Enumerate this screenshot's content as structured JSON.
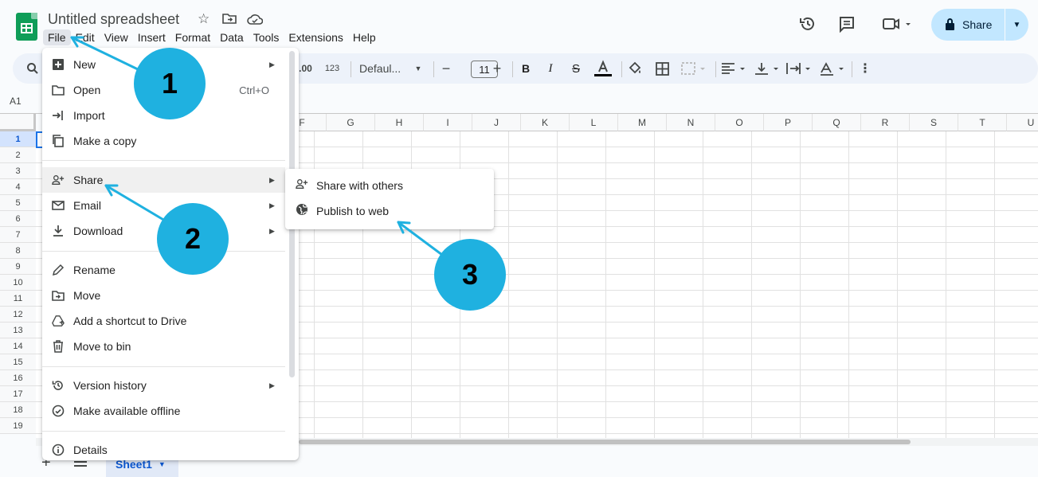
{
  "header": {
    "doc_title": "Untitled spreadsheet",
    "icons": [
      "star-icon",
      "move-to-folder-icon",
      "cloud-saved-icon"
    ],
    "menus": [
      "File",
      "Edit",
      "View",
      "Insert",
      "Format",
      "Data",
      "Tools",
      "Extensions",
      "Help"
    ],
    "right_icons": [
      "version-history-icon",
      "comments-icon",
      "meet-icon"
    ],
    "share_label": "Share"
  },
  "toolbar": {
    "decimal_label": ".00",
    "number_format_label": "123",
    "font_name": "Defaul...",
    "font_size": "11"
  },
  "formula_bar": {
    "name_box": "A1"
  },
  "grid": {
    "columns": [
      "F",
      "G",
      "H",
      "I",
      "J",
      "K",
      "L",
      "M",
      "N",
      "O",
      "P",
      "Q",
      "R",
      "S",
      "T",
      "U"
    ],
    "rows": [
      "1",
      "2",
      "3",
      "4",
      "5",
      "6",
      "7",
      "8",
      "9",
      "10",
      "11",
      "12",
      "13",
      "14",
      "15",
      "16",
      "17",
      "18",
      "19"
    ]
  },
  "sheets": {
    "active": "Sheet1"
  },
  "file_menu": {
    "items": [
      {
        "label": "New",
        "icon": "new-icon",
        "submenu": true
      },
      {
        "label": "Open",
        "icon": "open-folder-icon",
        "shortcut": "Ctrl+O"
      },
      {
        "label": "Import",
        "icon": "import-icon"
      },
      {
        "label": "Make a copy",
        "icon": "copy-icon"
      },
      {
        "label": "Share",
        "icon": "share-person-icon",
        "submenu": true
      },
      {
        "label": "Email",
        "icon": "email-icon",
        "submenu": true
      },
      {
        "label": "Download",
        "icon": "download-icon",
        "submenu": true
      },
      {
        "label": "Rename",
        "icon": "rename-pencil-icon"
      },
      {
        "label": "Move",
        "icon": "move-folder-icon"
      },
      {
        "label": "Add a shortcut to Drive",
        "icon": "drive-shortcut-icon"
      },
      {
        "label": "Move to bin",
        "icon": "trash-icon"
      },
      {
        "label": "Version history",
        "icon": "history-icon",
        "submenu": true
      },
      {
        "label": "Make available offline",
        "icon": "offline-icon"
      },
      {
        "label": "Details",
        "icon": "info-icon"
      }
    ]
  },
  "share_submenu": {
    "items": [
      {
        "label": "Share with others",
        "icon": "share-person-icon"
      },
      {
        "label": "Publish to web",
        "icon": "globe-icon"
      }
    ]
  },
  "annotations": {
    "steps": [
      "1",
      "2",
      "3"
    ],
    "color": "#1fb1e0"
  }
}
